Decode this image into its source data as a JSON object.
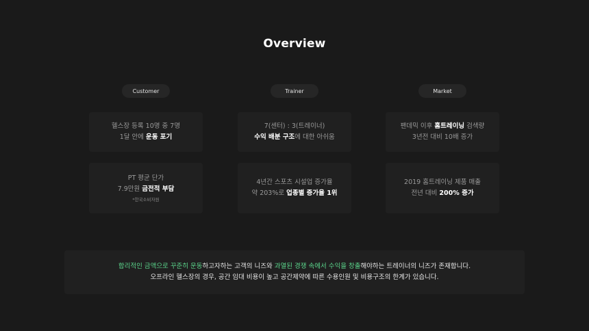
{
  "title": "Overview",
  "columns": [
    {
      "label": "Customer",
      "top": [
        [
          {
            "t": "헬스장 등록 10명 중 7명",
            "h": false
          }
        ],
        [
          {
            "t": "1달 안에 ",
            "h": false
          },
          {
            "t": "운동 포기",
            "h": true
          }
        ]
      ],
      "bottom": [
        [
          {
            "t": "PT 평균 단가",
            "h": false
          }
        ],
        [
          {
            "t": "7.9만원 ",
            "h": false
          },
          {
            "t": "금전적 부담",
            "h": true
          }
        ]
      ],
      "note": "*한국소비자원"
    },
    {
      "label": "Trainer",
      "top": [
        [
          {
            "t": "7(센터) : 3(트레이너)",
            "h": false
          }
        ],
        [
          {
            "t": "수익 배분 구조",
            "h": true
          },
          {
            "t": "에 대한 아쉬움",
            "h": false
          }
        ]
      ],
      "bottom": [
        [
          {
            "t": "4년간 스포츠 시설업 증가율",
            "h": false
          }
        ],
        [
          {
            "t": "약 203%로 ",
            "h": false
          },
          {
            "t": "업종별 증가율 1위",
            "h": true
          }
        ]
      ],
      "note": ""
    },
    {
      "label": "Market",
      "top": [
        [
          {
            "t": "팬데믹 이후 ",
            "h": false
          },
          {
            "t": "홈트레이닝",
            "h": true
          },
          {
            "t": " 검색량",
            "h": false
          }
        ],
        [
          {
            "t": "3년전 대비 10배 증가",
            "h": false
          }
        ]
      ],
      "bottom": [
        [
          {
            "t": "2019 홈트레이닝 제품 매출",
            "h": false
          }
        ],
        [
          {
            "t": "전년 대비 ",
            "h": false
          },
          {
            "t": "200% 증가",
            "h": true
          }
        ]
      ],
      "note": ""
    }
  ],
  "summary": [
    [
      {
        "t": "합리적인 금액으로 꾸준히 운동",
        "g": true
      },
      {
        "t": "하고자하는 고객의 니즈와 ",
        "g": false
      },
      {
        "t": "과열된 경쟁 속에서 수익을 창출",
        "g": true
      },
      {
        "t": "해야하는 트레이너의 니즈가 존재합니다.",
        "g": false
      }
    ],
    [
      {
        "t": "오프라인 헬스장의 경우, 공간 임대 비용이 높고 공간제약에 따른 수용인원 및 비용구조의 한계가 있습니다.",
        "g": false
      }
    ]
  ],
  "colors": {
    "background": "#1a1a1a",
    "card": "#202020",
    "highlight": "#5bd68c"
  }
}
